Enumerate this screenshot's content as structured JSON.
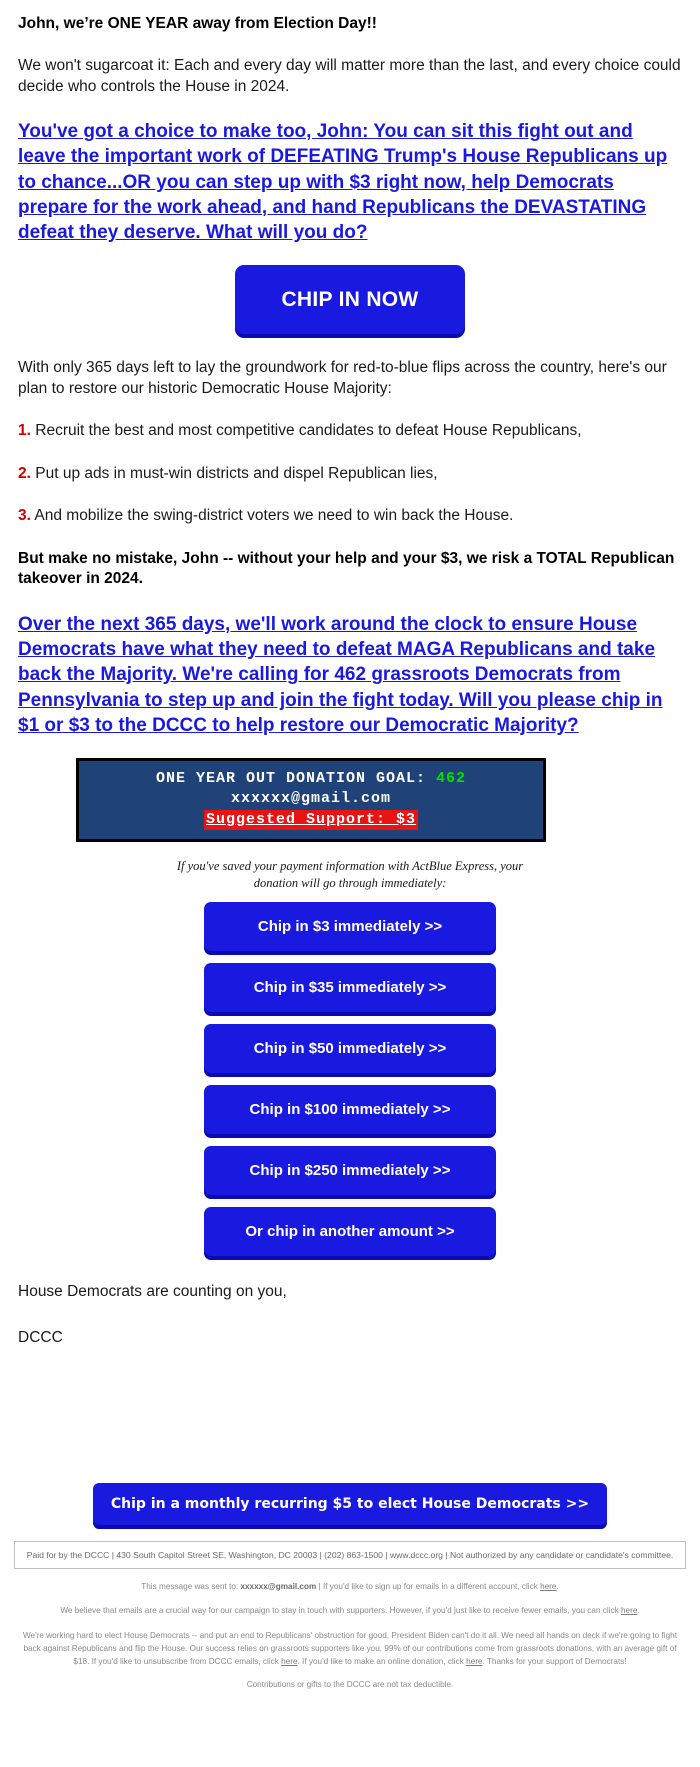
{
  "email": {
    "headline": "John, we’re ONE YEAR away from Election Day!!",
    "intro_paragraph": "We won't sugarcoat it: Each and every day will matter more than the last, and every choice could decide who controls the House in 2024.",
    "choice_link": "You've got a choice to make too, John: You can sit this fight out and leave the important work of DEFEATING Trump's House Republicans up to chance...OR you can step up with $3 right now, help Democrats prepare for the work ahead, and hand Republicans the DEVASTATING defeat they deserve. What will you do?",
    "main_cta_label": "CHIP IN NOW",
    "plan_intro": "With only 365 days left to lay the groundwork for red-to-blue flips across the country, here's our plan to restore our historic Democratic House Majority:",
    "plan_items": [
      {
        "num": "1.",
        "text": "Recruit the best and most competitive candidates to defeat House Republicans,"
      },
      {
        "num": "2.",
        "text": "Put up ads in must-win districts and dispel Republican lies,"
      },
      {
        "num": "3.",
        "text": "And mobilize the swing-district voters we need to win back the House."
      }
    ],
    "warning": "But make no mistake, John -- without your help and your $3, we risk a TOTAL Republican takeover in 2024.",
    "second_link": "Over the next 365 days, we'll work around the clock to ensure House Democrats have what they need to defeat MAGA Republicans and take back the Majority. We're calling for 462 grassroots Democrats from Pennsylvania to step up and join the fight today. Will you please chip in $1 or $3 to the DCCC to help restore our Democratic Majority?",
    "signoff_line": "House Democrats are counting on you,",
    "signature": "DCCC"
  },
  "goal_box": {
    "goal_label": "ONE YEAR OUT DONATION GOAL:",
    "goal_value": "462",
    "email_address": "xxxxxx@gmail.com",
    "suggested_support": "Suggested Support: $3",
    "background_color": "#1f4378",
    "goal_value_color": "#00e000",
    "suggested_highlight_color": "#e81313"
  },
  "express_note": "If you've saved your payment information with ActBlue Express, your donation will go through immediately:",
  "amount_buttons": [
    {
      "label": "Chip in $3 immediately >>"
    },
    {
      "label": "Chip in $35 immediately >>"
    },
    {
      "label": "Chip in $50 immediately >>"
    },
    {
      "label": "Chip in $100 immediately >>"
    },
    {
      "label": "Chip in $250 immediately >>"
    },
    {
      "label": "Or chip in another amount >>"
    }
  ],
  "monthly_button": {
    "label": "Chip in a monthly recurring $5 to elect House Democrats >>"
  },
  "footer": {
    "disclaimer": "Paid for by the DCCC | 430 South Capitol Street SE, Washington, DC 20003 | (202) 863-1500 | www.dccc.org | Not authorized by any candidate or candidate's committee.",
    "sent_to_prefix": "This message was sent to: ",
    "sent_to_email": "xxxxxx@gmail.com",
    "sent_to_suffix": " | If you'd like to sign up for emails in a different account, click ",
    "sent_to_link": "here",
    "fewer_emails": "We believe that emails are a crucial way for our campaign to stay in touch with supporters. However, if you'd just like to receive fewer emails, you can click ",
    "fewer_emails_link": "here",
    "long_paragraph_a": "We're working hard to elect House Democrats -- and put an end to Republicans' obstruction for good. President Biden can't do it all. We need all hands on deck if we're going to fight back against Republicans and flip the House. Our success relies on grassroots supporters like you. 99% of our contributions come from grassroots donations, with an average gift of $18. If you'd like to unsubscribe from DCCC emails, click ",
    "unsubscribe_link": "here",
    "long_paragraph_b": ". If you'd like to make an online donation, click ",
    "donate_link": "here",
    "long_paragraph_c": ". Thanks for your support of Democrats!",
    "tax_note": "Contributions or gifts to the DCCC are not tax deductible."
  },
  "colors": {
    "link_blue": "#1a19e0",
    "button_blue": "#1a19e0",
    "button_shadow": "#0b0ab0",
    "number_red": "#cc0000"
  }
}
